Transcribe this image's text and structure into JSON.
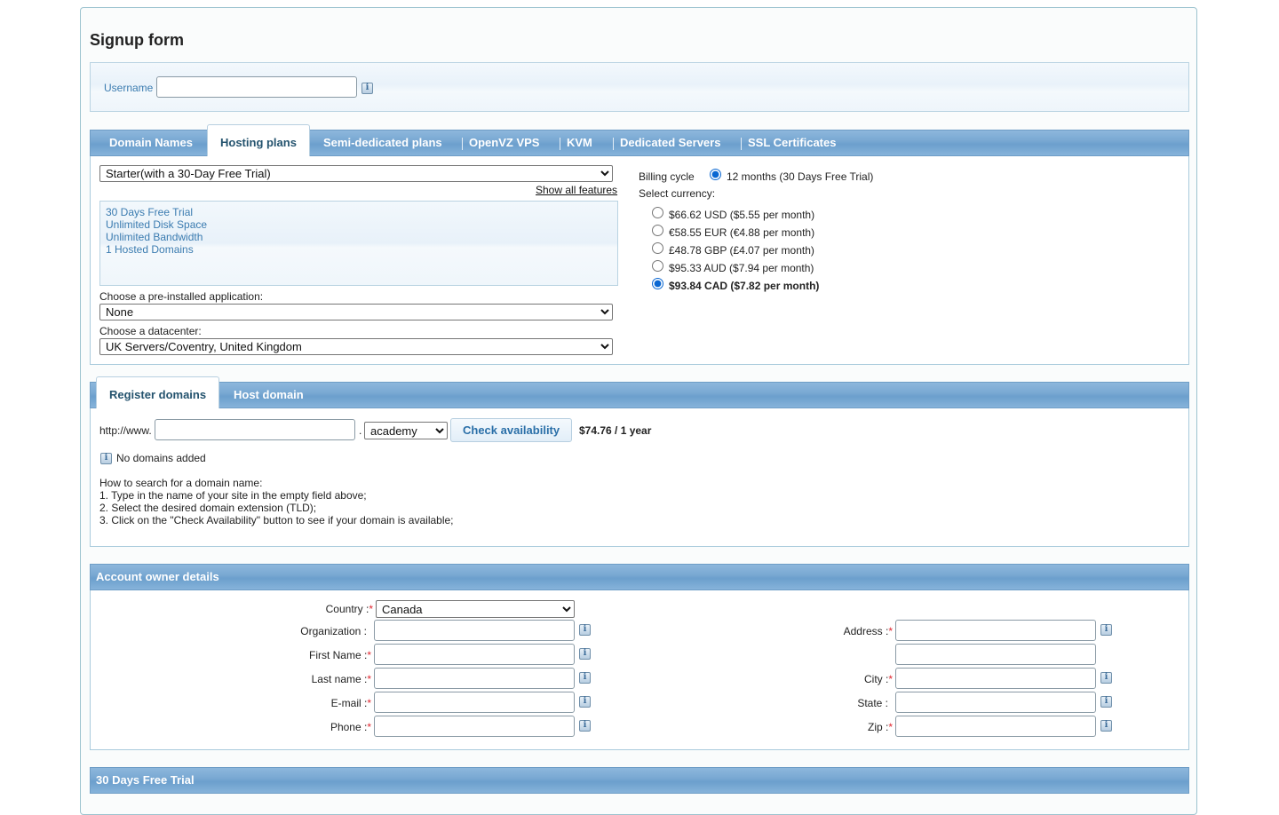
{
  "page_title": "Signup form",
  "username": {
    "label": "Username",
    "value": ""
  },
  "hosting_tabs": [
    "Domain Names",
    "Hosting plans",
    "Semi-dedicated plans",
    "OpenVZ VPS",
    "KVM",
    "Dedicated Servers",
    "SSL Certificates"
  ],
  "hosting": {
    "plan_selected": "Starter(with a 30-Day Free Trial)",
    "show_all_features": "Show all features",
    "features": [
      "30 Days Free Trial",
      "Unlimited Disk Space",
      "Unlimited Bandwidth",
      "1 Hosted Domains"
    ],
    "app_label": "Choose a pre-installed application:",
    "app_selected": "None",
    "datacenter_label": "Choose a datacenter:",
    "datacenter_selected": "UK Servers/Coventry, United Kingdom",
    "billing_label": "Billing cycle",
    "billing_option": "12 months (30 Days Free Trial)",
    "currency_label": "Select currency:",
    "currencies": [
      "$66.62 USD ($5.55 per month)",
      "€58.55 EUR (€4.88 per month)",
      "£48.78 GBP (£4.07 per month)",
      "$95.33 AUD ($7.94 per month)",
      "$93.84 CAD ($7.82 per month)"
    ],
    "currency_selected_index": 4
  },
  "domain_tabs": [
    "Register domains",
    "Host domain"
  ],
  "domain": {
    "prefix": "http://www.",
    "dot": ".",
    "tld_selected": "academy",
    "check_button": "Check availability",
    "price": "$74.76 / 1 year",
    "no_domains": "No domains added",
    "howto": [
      "How to search for a domain name:",
      "1. Type in the name of your site in the empty field above;",
      "2. Select the desired domain extension (TLD);",
      "3. Click on the \"Check Availability\" button to see if your domain is available;"
    ]
  },
  "account": {
    "section_title": "Account owner details",
    "country_label": "Country :",
    "country_selected": "Canada",
    "organization_label": "Organization :",
    "first_name_label": "First Name :",
    "last_name_label": "Last name :",
    "email_label": "E-mail :",
    "phone_label": "Phone :",
    "address_label": "Address :",
    "city_label": "City :",
    "state_label": "State :",
    "zip_label": "Zip :",
    "required_mark": "*"
  },
  "trial_section_title": "30 Days Free Trial"
}
